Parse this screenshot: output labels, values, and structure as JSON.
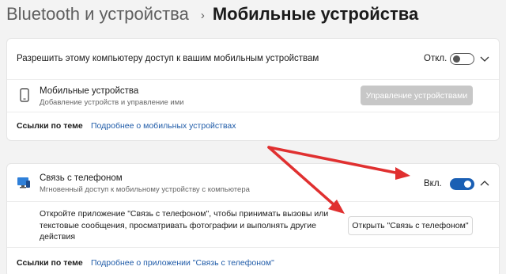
{
  "breadcrumb": {
    "parent": "Bluetooth и устройства",
    "separator": "›",
    "current": "Мобильные устройства"
  },
  "allow_access": {
    "label": "Разрешить этому компьютеру доступ к вашим мобильным устройствам",
    "toggle_text": "Откл.",
    "toggle_state": "off"
  },
  "mobile_devices": {
    "icon": "phone-icon",
    "title": "Мобильные устройства",
    "subtitle": "Добавление устройств и управление ими",
    "manage_button": "Управление устройствами"
  },
  "related1": {
    "label": "Ссылки по теме",
    "link": "Подробнее о мобильных устройствах"
  },
  "phone_link": {
    "icon": "phone-link-icon",
    "title": "Связь с телефоном",
    "subtitle": "Мгновенный доступ к мобильному устройству с компьютера",
    "toggle_text": "Вкл.",
    "toggle_state": "on",
    "desc_line1": "Откройте приложение \"Связь с телефоном\", чтобы принимать вызовы или",
    "desc_line2": "текстовые сообщения, просматривать фотографии и выполнять другие",
    "desc_line3": "действия",
    "open_button": "Открыть \"Связь с телефоном\""
  },
  "related2": {
    "label": "Ссылки по теме",
    "link": "Подробнее о приложении \"Связь с телефоном\""
  },
  "colors": {
    "accent": "#1a5fb4",
    "link": "#1f5ba8",
    "annotation_arrow": "#e03030"
  }
}
